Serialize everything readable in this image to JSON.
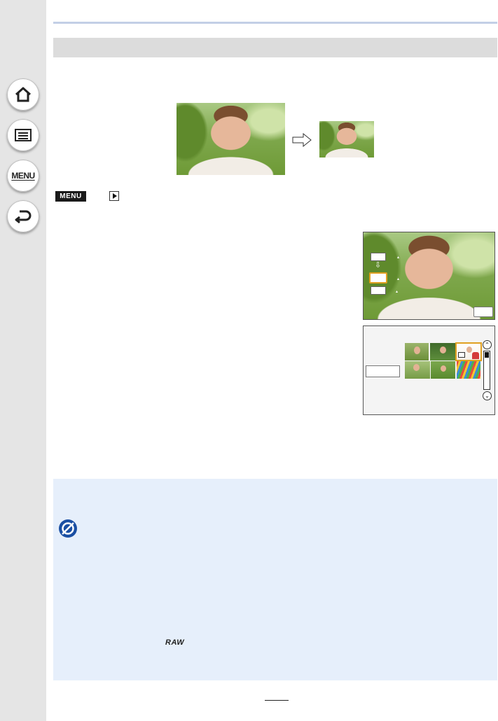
{
  "sidebar": {
    "items": [
      {
        "icon": "home-icon"
      },
      {
        "icon": "list-icon"
      },
      {
        "icon": "menu-icon",
        "label": "MENU"
      },
      {
        "icon": "back-icon"
      }
    ]
  },
  "breadcrumb": {
    "menu_badge": "MENU",
    "playback_icon": "playback-icon"
  },
  "note": {
    "icon": "not-available-icon",
    "raw_label": "RAW"
  },
  "colors": {
    "sidebar_bg": "#e5e5e5",
    "section_bar": "#dcdcdc",
    "note_bg": "#e6effb",
    "highlight": "#e0a020"
  }
}
